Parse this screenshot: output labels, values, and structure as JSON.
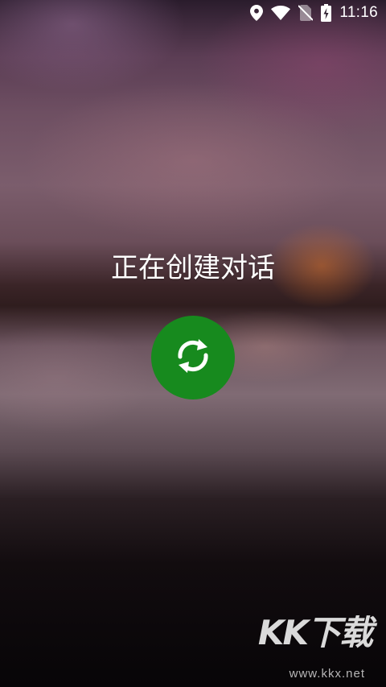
{
  "status_bar": {
    "time": "11:16",
    "icons": [
      "location-icon",
      "wifi-icon",
      "no-sim-icon",
      "battery-charging-icon"
    ]
  },
  "screen": {
    "title": "正在创建对话",
    "button_icon": "refresh-icon",
    "button_color": "#178a1e"
  },
  "watermark": {
    "logo_text": "KK下载",
    "url": "www.kkx.net"
  }
}
